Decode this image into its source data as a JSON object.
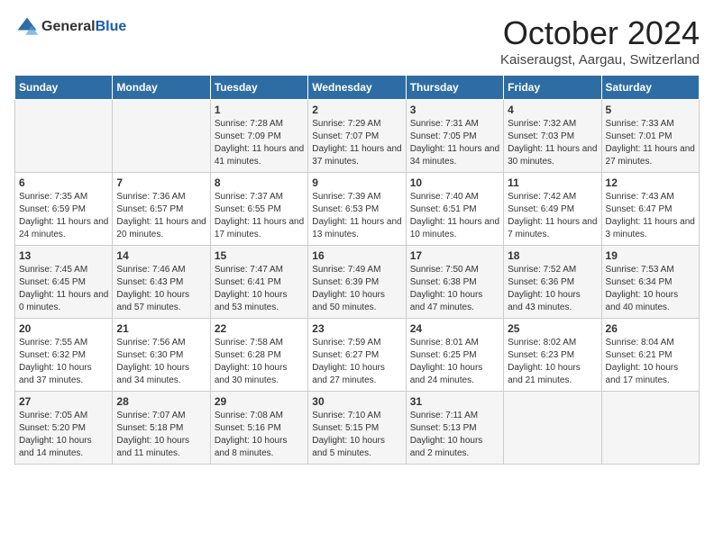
{
  "header": {
    "logo_general": "General",
    "logo_blue": "Blue",
    "month_title": "October 2024",
    "location": "Kaiseraugst, Aargau, Switzerland"
  },
  "weekdays": [
    "Sunday",
    "Monday",
    "Tuesday",
    "Wednesday",
    "Thursday",
    "Friday",
    "Saturday"
  ],
  "weeks": [
    [
      {
        "day": "",
        "info": ""
      },
      {
        "day": "",
        "info": ""
      },
      {
        "day": "1",
        "info": "Sunrise: 7:28 AM\nSunset: 7:09 PM\nDaylight: 11 hours and 41 minutes."
      },
      {
        "day": "2",
        "info": "Sunrise: 7:29 AM\nSunset: 7:07 PM\nDaylight: 11 hours and 37 minutes."
      },
      {
        "day": "3",
        "info": "Sunrise: 7:31 AM\nSunset: 7:05 PM\nDaylight: 11 hours and 34 minutes."
      },
      {
        "day": "4",
        "info": "Sunrise: 7:32 AM\nSunset: 7:03 PM\nDaylight: 11 hours and 30 minutes."
      },
      {
        "day": "5",
        "info": "Sunrise: 7:33 AM\nSunset: 7:01 PM\nDaylight: 11 hours and 27 minutes."
      }
    ],
    [
      {
        "day": "6",
        "info": "Sunrise: 7:35 AM\nSunset: 6:59 PM\nDaylight: 11 hours and 24 minutes."
      },
      {
        "day": "7",
        "info": "Sunrise: 7:36 AM\nSunset: 6:57 PM\nDaylight: 11 hours and 20 minutes."
      },
      {
        "day": "8",
        "info": "Sunrise: 7:37 AM\nSunset: 6:55 PM\nDaylight: 11 hours and 17 minutes."
      },
      {
        "day": "9",
        "info": "Sunrise: 7:39 AM\nSunset: 6:53 PM\nDaylight: 11 hours and 13 minutes."
      },
      {
        "day": "10",
        "info": "Sunrise: 7:40 AM\nSunset: 6:51 PM\nDaylight: 11 hours and 10 minutes."
      },
      {
        "day": "11",
        "info": "Sunrise: 7:42 AM\nSunset: 6:49 PM\nDaylight: 11 hours and 7 minutes."
      },
      {
        "day": "12",
        "info": "Sunrise: 7:43 AM\nSunset: 6:47 PM\nDaylight: 11 hours and 3 minutes."
      }
    ],
    [
      {
        "day": "13",
        "info": "Sunrise: 7:45 AM\nSunset: 6:45 PM\nDaylight: 11 hours and 0 minutes."
      },
      {
        "day": "14",
        "info": "Sunrise: 7:46 AM\nSunset: 6:43 PM\nDaylight: 10 hours and 57 minutes."
      },
      {
        "day": "15",
        "info": "Sunrise: 7:47 AM\nSunset: 6:41 PM\nDaylight: 10 hours and 53 minutes."
      },
      {
        "day": "16",
        "info": "Sunrise: 7:49 AM\nSunset: 6:39 PM\nDaylight: 10 hours and 50 minutes."
      },
      {
        "day": "17",
        "info": "Sunrise: 7:50 AM\nSunset: 6:38 PM\nDaylight: 10 hours and 47 minutes."
      },
      {
        "day": "18",
        "info": "Sunrise: 7:52 AM\nSunset: 6:36 PM\nDaylight: 10 hours and 43 minutes."
      },
      {
        "day": "19",
        "info": "Sunrise: 7:53 AM\nSunset: 6:34 PM\nDaylight: 10 hours and 40 minutes."
      }
    ],
    [
      {
        "day": "20",
        "info": "Sunrise: 7:55 AM\nSunset: 6:32 PM\nDaylight: 10 hours and 37 minutes."
      },
      {
        "day": "21",
        "info": "Sunrise: 7:56 AM\nSunset: 6:30 PM\nDaylight: 10 hours and 34 minutes."
      },
      {
        "day": "22",
        "info": "Sunrise: 7:58 AM\nSunset: 6:28 PM\nDaylight: 10 hours and 30 minutes."
      },
      {
        "day": "23",
        "info": "Sunrise: 7:59 AM\nSunset: 6:27 PM\nDaylight: 10 hours and 27 minutes."
      },
      {
        "day": "24",
        "info": "Sunrise: 8:01 AM\nSunset: 6:25 PM\nDaylight: 10 hours and 24 minutes."
      },
      {
        "day": "25",
        "info": "Sunrise: 8:02 AM\nSunset: 6:23 PM\nDaylight: 10 hours and 21 minutes."
      },
      {
        "day": "26",
        "info": "Sunrise: 8:04 AM\nSunset: 6:21 PM\nDaylight: 10 hours and 17 minutes."
      }
    ],
    [
      {
        "day": "27",
        "info": "Sunrise: 7:05 AM\nSunset: 5:20 PM\nDaylight: 10 hours and 14 minutes."
      },
      {
        "day": "28",
        "info": "Sunrise: 7:07 AM\nSunset: 5:18 PM\nDaylight: 10 hours and 11 minutes."
      },
      {
        "day": "29",
        "info": "Sunrise: 7:08 AM\nSunset: 5:16 PM\nDaylight: 10 hours and 8 minutes."
      },
      {
        "day": "30",
        "info": "Sunrise: 7:10 AM\nSunset: 5:15 PM\nDaylight: 10 hours and 5 minutes."
      },
      {
        "day": "31",
        "info": "Sunrise: 7:11 AM\nSunset: 5:13 PM\nDaylight: 10 hours and 2 minutes."
      },
      {
        "day": "",
        "info": ""
      },
      {
        "day": "",
        "info": ""
      }
    ]
  ]
}
